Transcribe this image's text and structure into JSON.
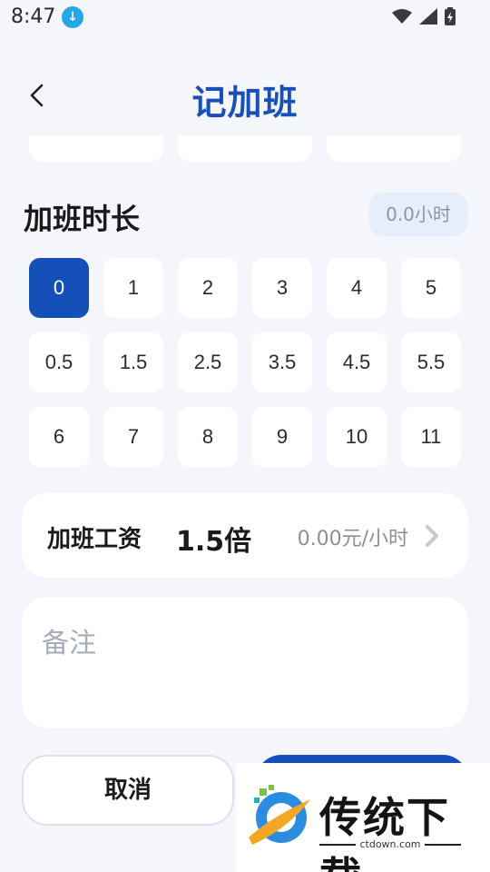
{
  "status_bar": {
    "time": "8:47",
    "icons": [
      "download-icon",
      "wifi-icon",
      "signal-icon",
      "battery-icon"
    ]
  },
  "header": {
    "title": "记加班",
    "back_icon": "chevron-left-icon"
  },
  "duration": {
    "title": "加班时长",
    "hours_display": "0.0小时",
    "selected": "0",
    "options": [
      "0",
      "1",
      "2",
      "3",
      "4",
      "5",
      "0.5",
      "1.5",
      "2.5",
      "3.5",
      "4.5",
      "5.5",
      "6",
      "7",
      "8",
      "9",
      "10",
      "11"
    ]
  },
  "wage": {
    "label": "加班工资",
    "multiplier": "1.5倍",
    "rate": "0.00元/小时"
  },
  "note": {
    "placeholder": "备注"
  },
  "actions": {
    "cancel_label": "取消"
  },
  "watermark": {
    "brand": "传统下载",
    "domain": "ctdown.com"
  },
  "colors": {
    "accent": "#1450b8",
    "title_blue": "#1850b8",
    "background": "#f4f6fc"
  }
}
